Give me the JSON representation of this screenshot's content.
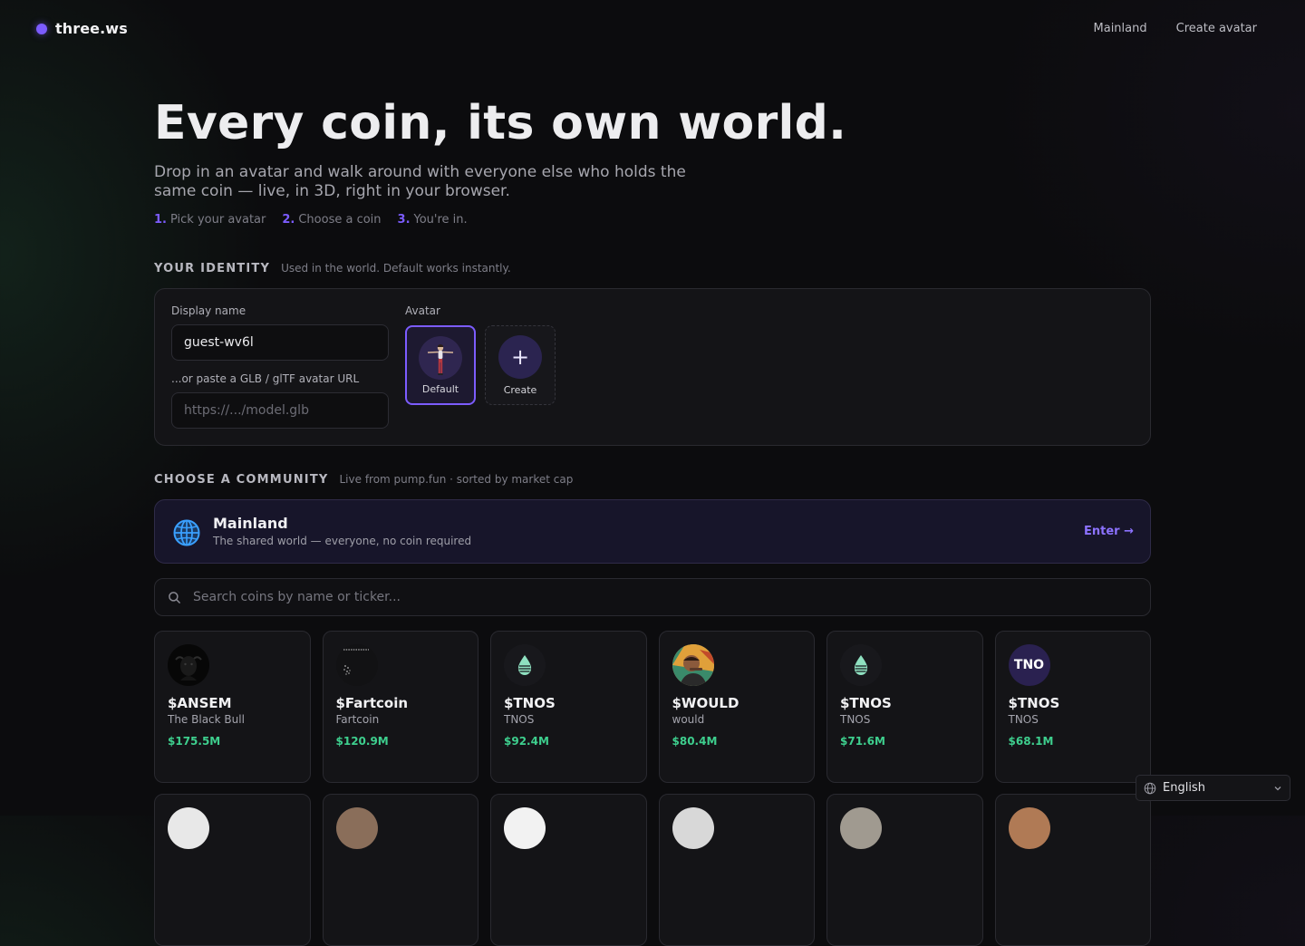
{
  "brand": {
    "name": "three.ws",
    "accent": "#7c5cff"
  },
  "nav": {
    "links": [
      "Mainland",
      "Create avatar"
    ]
  },
  "hero": {
    "title": "Every coin, its own world.",
    "subtitle": "Drop in an avatar and walk around with everyone else who holds the same coin — live, in 3D, right in your browser.",
    "steps": [
      {
        "num": "1.",
        "label": "Pick your avatar"
      },
      {
        "num": "2.",
        "label": "Choose a coin"
      },
      {
        "num": "3.",
        "label": "You're in."
      }
    ]
  },
  "identity": {
    "section_title": "YOUR IDENTITY",
    "section_note": "Used in the world. Default works instantly.",
    "display_name_label": "Display name",
    "display_name_value": "guest-wv6l",
    "url_label": "...or paste a GLB / glTF avatar URL",
    "url_placeholder": "https://.../model.glb",
    "avatar_label": "Avatar",
    "avatars": [
      {
        "label": "Default",
        "selected": true
      },
      {
        "label": "Create",
        "selected": false
      }
    ]
  },
  "community": {
    "section_title": "CHOOSE A COMMUNITY",
    "section_note": "Live from pump.fun · sorted by market cap",
    "mainland": {
      "name": "Mainland",
      "desc": "The shared world — everyone, no coin required",
      "enter": "Enter →"
    },
    "search_placeholder": "Search coins by name or ticker...",
    "coins": [
      {
        "ticker": "$ANSEM",
        "name": "The Black Bull",
        "mcap": "$175.5M",
        "icon": "black-bull-avatar"
      },
      {
        "ticker": "$Fartcoin",
        "name": "Fartcoin",
        "mcap": "$120.9M",
        "icon": "fartcoin-avatar"
      },
      {
        "ticker": "$TNOS",
        "name": "TNOS",
        "mcap": "$92.4M",
        "icon": "drop-avatar"
      },
      {
        "ticker": "$WOULD",
        "name": "would",
        "mcap": "$80.4M",
        "icon": "would-avatar"
      },
      {
        "ticker": "$TNOS",
        "name": "TNOS",
        "mcap": "$71.6M",
        "icon": "drop-avatar"
      },
      {
        "ticker": "$TNOS",
        "name": "TNOS",
        "mcap": "$68.1M",
        "icon": "text-avatar",
        "avatar_text": "TNO"
      }
    ]
  },
  "language": {
    "label": "English"
  },
  "colors": {
    "market_cap": "#3ecf8e",
    "accent": "#7c5cff",
    "background": "#0c0c0e"
  }
}
